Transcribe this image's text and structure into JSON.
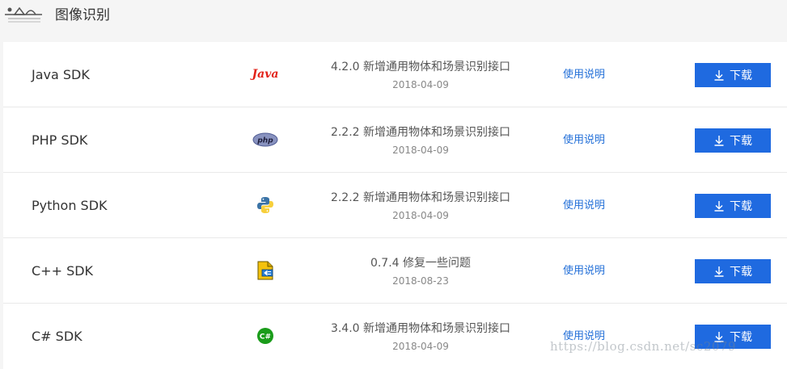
{
  "header": {
    "title": "图像识别",
    "logo_icon": "landscape-logo-icon"
  },
  "sdks": [
    {
      "name": "Java SDK",
      "icon": "java-icon",
      "icon_text": "Java",
      "version": "4.2.0 新增通用物体和场景识别接口",
      "date": "2018-04-09",
      "doc_label": "使用说明",
      "download_label": "下载"
    },
    {
      "name": "PHP SDK",
      "icon": "php-icon",
      "icon_text": "php",
      "version": "2.2.2 新增通用物体和场景识别接口",
      "date": "2018-04-09",
      "doc_label": "使用说明",
      "download_label": "下载"
    },
    {
      "name": "Python SDK",
      "icon": "python-icon",
      "version": "2.2.2 新增通用物体和场景识别接口",
      "date": "2018-04-09",
      "doc_label": "使用说明",
      "download_label": "下载"
    },
    {
      "name": "C++ SDK",
      "icon": "cpp-icon",
      "version": "0.7.4 修复一些问题",
      "date": "2018-08-23",
      "doc_label": "使用说明",
      "download_label": "下载"
    },
    {
      "name": "C# SDK",
      "icon": "csharp-icon",
      "icon_text": "C#",
      "version": "3.4.0 新增通用物体和场景识别接口",
      "date": "2018-04-09",
      "doc_label": "使用说明",
      "download_label": "下载"
    }
  ],
  "colors": {
    "accent": "#1f6ae0",
    "link": "#2470d8",
    "java": "#e2231a",
    "php": "#8892bf",
    "csharp": "#1a9c1a"
  },
  "watermark": "https://blog.csdn.net/sc2079"
}
